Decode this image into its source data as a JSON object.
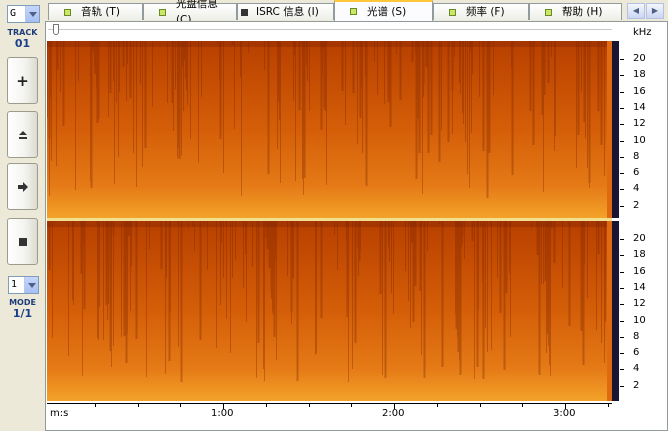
{
  "left": {
    "drive": "G",
    "track_label": "TRACK",
    "track_value": "01",
    "speed_value": "1",
    "mode_label": "MODE",
    "mode_value": "1/1"
  },
  "tabs": [
    {
      "label": "音轨 (T)",
      "icon": "green-square-icon"
    },
    {
      "label": "光盘信息 (C)",
      "icon": "green-square-icon"
    },
    {
      "label": "ISRC 信息 (I)",
      "icon": "dark-square-icon"
    },
    {
      "label": "光谱 (S)",
      "icon": "green-square-icon",
      "active": true
    },
    {
      "label": "频率 (F)",
      "icon": "green-square-icon"
    },
    {
      "label": "帮助 (H)",
      "icon": "green-square-icon"
    }
  ],
  "spectrum": {
    "unit": "kHz",
    "khz_ticks": [
      "20",
      "18",
      "16",
      "14",
      "12",
      "10",
      "8",
      "6",
      "4",
      "2"
    ],
    "time_axis_label": "m:s",
    "time_ticks": [
      "1:00",
      "2:00",
      "3:00"
    ],
    "colors": {
      "low": "#c24a00",
      "high": "#f5a52c",
      "bg": "#1a1530"
    }
  }
}
